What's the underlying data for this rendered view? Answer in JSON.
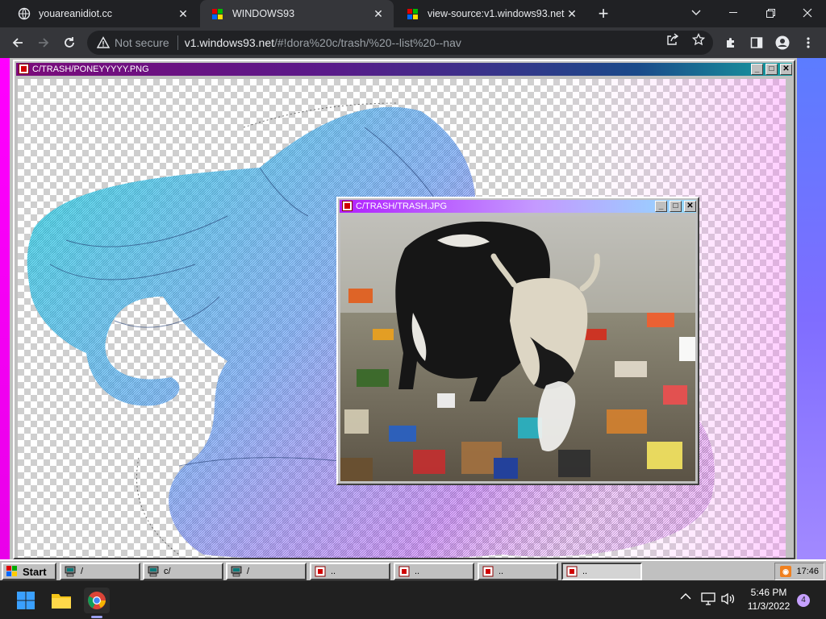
{
  "browser": {
    "tabs": [
      {
        "title": "youareanidiot.cc",
        "active": false
      },
      {
        "title": "WINDOWS93",
        "active": true
      },
      {
        "title": "view-source:v1.windows93.net",
        "active": false
      }
    ],
    "url": {
      "security_label": "Not secure",
      "host": "v1.windows93.net",
      "path": "/#!dora%20c/trash/%20--list%20--nav"
    }
  },
  "win93": {
    "pony_window": {
      "title": "C/TRASH/PONEYYYYY.PNG"
    },
    "trash_window": {
      "title": "C/TRASH/TRASH.JPG"
    },
    "taskbar": {
      "start_label": "Start",
      "buttons": [
        {
          "label": "/",
          "icon": "computer-icon"
        },
        {
          "label": "c/",
          "icon": "computer-icon"
        },
        {
          "label": "/",
          "icon": "computer-icon"
        },
        {
          "label": "..",
          "icon": "image-file-icon"
        },
        {
          "label": "..",
          "icon": "image-file-icon"
        },
        {
          "label": "..",
          "icon": "image-file-icon"
        },
        {
          "label": "..",
          "icon": "image-file-icon"
        }
      ],
      "clock": "17:46"
    }
  },
  "os": {
    "clock_time": "5:46 PM",
    "clock_date": "11/3/2022",
    "notification_count": "4",
    "pinned": [
      "start-icon",
      "file-explorer-icon",
      "chrome-icon"
    ]
  }
}
